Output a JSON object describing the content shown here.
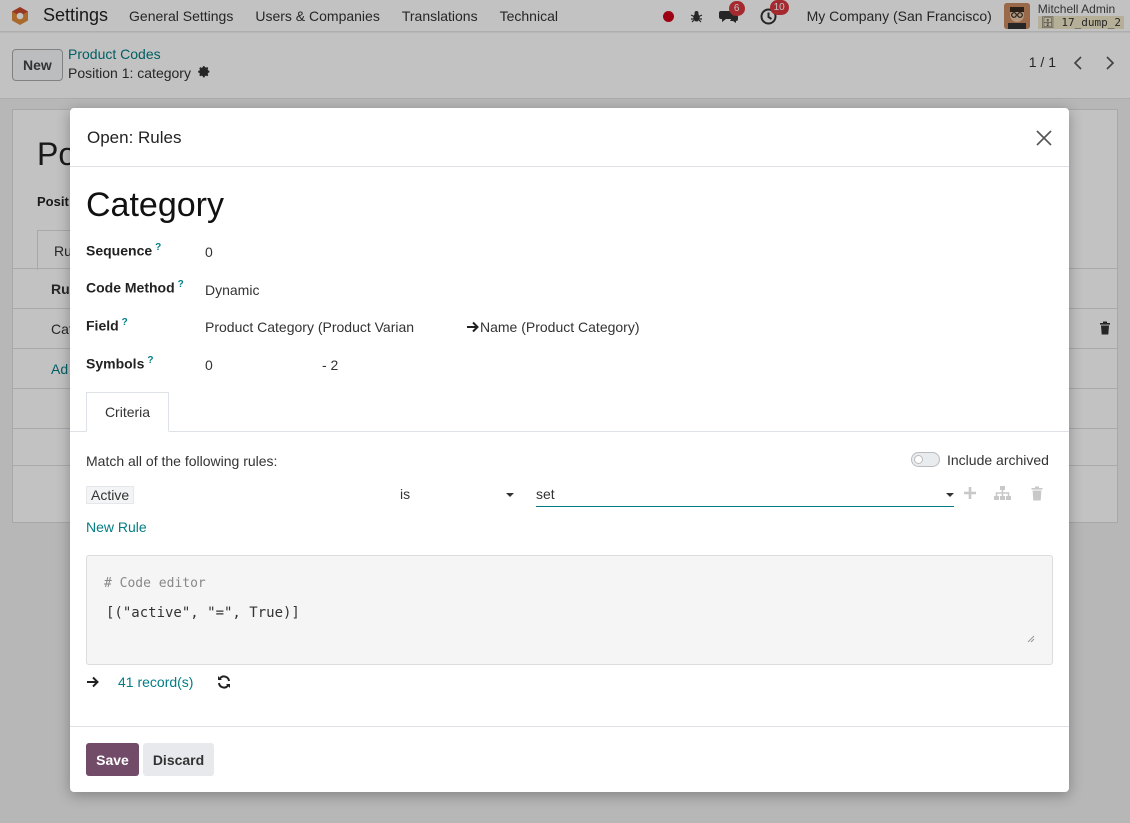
{
  "navbar": {
    "app_name": "Settings",
    "menu": [
      "General Settings",
      "Users & Companies",
      "Translations",
      "Technical"
    ],
    "messages_badge": "6",
    "activities_badge": "10",
    "company": "My Company (San Francisco)",
    "user_name": "Mitchell Admin",
    "db_name": "17_dump_2"
  },
  "control": {
    "new_label": "New",
    "breadcrumb_parent": "Product Codes",
    "breadcrumb_current": "Position 1: category",
    "pager": "1 / 1"
  },
  "background": {
    "title_fragment": "Po",
    "label_fragment": "Posit",
    "tab_fragment": "Ru",
    "col_fragment": "Ru",
    "row_fragment": "Cat",
    "add_fragment": "Ad"
  },
  "modal": {
    "title": "Open: Rules",
    "record_title": "Category",
    "fields": {
      "sequence_label": "Sequence",
      "sequence_value": "0",
      "code_method_label": "Code Method",
      "code_method_value": "Dynamic",
      "field_label": "Field",
      "field_value": "Product Category (Product Varian",
      "field_related": "Name (Product Category)",
      "symbols_label": "Symbols",
      "symbols_value_1": "0",
      "symbols_value_2": "- 2",
      "help_mark": "?"
    },
    "tab_label": "Criteria",
    "criteria": {
      "match_text": "Match all of the following rules:",
      "include_archived": "Include archived",
      "rule_field": "Active",
      "rule_operator": "is",
      "rule_value": "set",
      "new_rule": "New Rule",
      "code_comment": "# Code editor",
      "code_domain": "[(\"active\", \"=\", True)]",
      "record_count": "41 record(s)"
    },
    "save_label": "Save",
    "discard_label": "Discard"
  },
  "colors": {
    "primary": "#714b67",
    "link": "#017e84",
    "badge": "#d9383e"
  }
}
